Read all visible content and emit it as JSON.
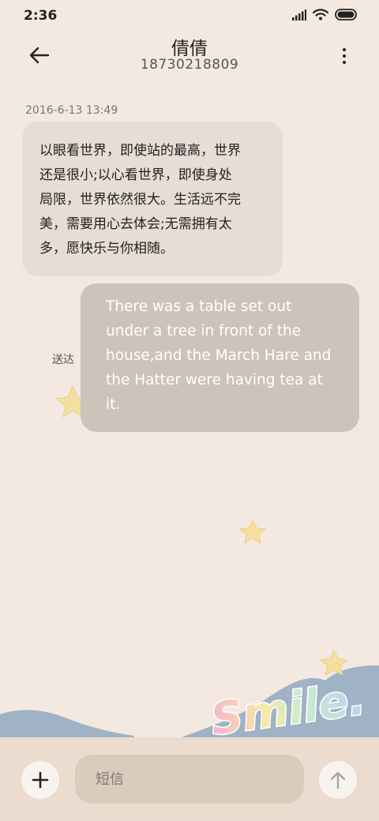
{
  "status_bar": {
    "time": "2:36",
    "icons": [
      "signal-icon",
      "wifi-icon",
      "battery-icon"
    ]
  },
  "header": {
    "contact_name": "倩倩",
    "contact_number": "18730218809",
    "back_icon": "arrow-left-icon",
    "more_icon": "more-vertical-icon"
  },
  "conversation": {
    "timestamp": "2016-6-13 13:49",
    "messages": [
      {
        "direction": "incoming",
        "lines": [
          "以眼看世界，即使站的最高，世界",
          "还是很小;以心看世界，即使身处",
          "局限，世界依然很大。生活远不完",
          "美，需要用心去体会;无需拥有太",
          "多，愿快乐与你相随。"
        ]
      },
      {
        "direction": "outgoing",
        "status": "送达",
        "lines": [
          "There was a table set out",
          "under a tree in front of the",
          "house,and the March Hare and",
          "the Hatter were having tea at",
          "it."
        ]
      }
    ]
  },
  "background": {
    "decoration_text": "Smile.",
    "decorations": [
      "star-icon",
      "cloud-wave"
    ]
  },
  "composer": {
    "placeholder": "短信",
    "value": "",
    "add_icon": "plus-icon",
    "send_icon": "arrow-up-icon"
  },
  "colors": {
    "background": "#f4e9e0",
    "incoming_bubble": "#e6ddd5",
    "outgoing_bubble": "#cdc3ba",
    "input_bar": "#ebdccf",
    "input_field": "#dbcbbd",
    "wave": "#9fb2c6",
    "star": "#f3dfa0"
  }
}
